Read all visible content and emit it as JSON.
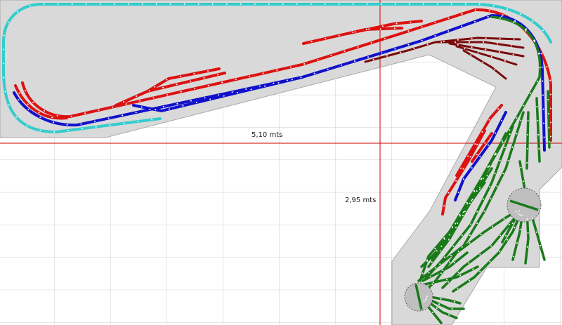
{
  "dimensions": {
    "width_label": "5,10 mts",
    "height_label": "2,95 mts"
  },
  "colors": {
    "background": "#ffffff",
    "grid": "#cccccc",
    "baseboard": "#d9d9d9",
    "baseboard_edge": "#a8a8a8",
    "guide_line": "#cc0000",
    "track_cyan": "#33cccc",
    "track_red": "#dd1111",
    "track_blue": "#1010cc",
    "track_dark_red": "#7a0a0a",
    "track_green": "#1a7a1a",
    "joint": "#ffffff",
    "turntable": "#bfbfbf"
  },
  "tracks": {
    "cyan": "outer-loop",
    "red": "main-line-red",
    "blue": "main-line-blue",
    "dark_red": "upper-yard-spurs",
    "green": "staging-yard"
  }
}
